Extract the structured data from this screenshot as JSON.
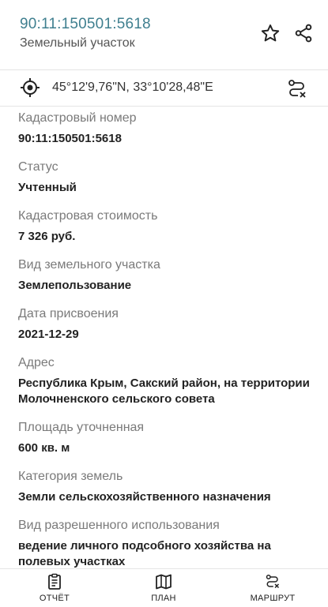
{
  "header": {
    "title": "90:11:150501:5618",
    "subtitle": "Земельный участок"
  },
  "location": {
    "coordinates": "45°12'9,76\"N, 33°10'28,48\"E"
  },
  "fields": [
    {
      "label": "Кадастровый номер",
      "value": "90:11:150501:5618"
    },
    {
      "label": "Статус",
      "value": "Учтенный"
    },
    {
      "label": "Кадастровая стоимость",
      "value": "7 326 руб."
    },
    {
      "label": "Вид земельного участка",
      "value": "Землепользование"
    },
    {
      "label": "Дата присвоения",
      "value": "2021-12-29"
    },
    {
      "label": "Адрес",
      "value": "Республика Крым, Сакский район, на территории Молочненского сельского совета"
    },
    {
      "label": "Площадь уточненная",
      "value": "600 кв. м"
    },
    {
      "label": "Категория земель",
      "value": "Земли сельскохозяйственного назначения"
    },
    {
      "label": "Вид разрешенного использования",
      "value": "ведение личного подсобного хозяйства на полевых участках"
    }
  ],
  "bottom_nav": {
    "report": "ОТЧЁТ",
    "plan": "ПЛАН",
    "route": "МАРШРУТ"
  },
  "icons": {
    "favorite": "star-icon",
    "share": "share-icon",
    "my_location": "crosshair-icon",
    "route": "route-icon",
    "report": "clipboard-icon",
    "plan": "map-icon"
  },
  "colors": {
    "title": "#3f7f8f",
    "label": "#7a7a7a",
    "value": "#222222"
  }
}
